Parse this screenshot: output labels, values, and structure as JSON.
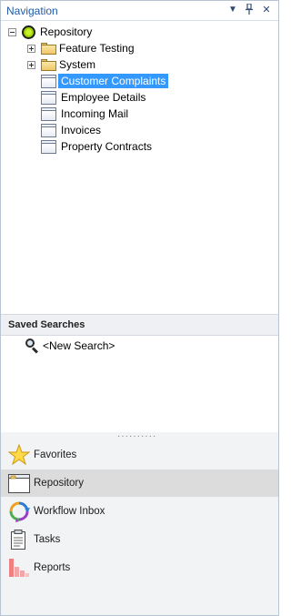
{
  "title": "Navigation",
  "title_buttons": {
    "dropdown": "▼",
    "pin": "📌",
    "close": "✕"
  },
  "tree": {
    "root": {
      "label": "Repository",
      "icon": "repository-icon"
    },
    "items": [
      {
        "label": "Feature Testing",
        "icon": "folder-icon",
        "expandable": true
      },
      {
        "label": "System",
        "icon": "folder-icon",
        "expandable": true
      },
      {
        "label": "Customer Complaints",
        "icon": "document-class-icon",
        "selected": true
      },
      {
        "label": "Employee Details",
        "icon": "document-class-icon"
      },
      {
        "label": "Incoming Mail",
        "icon": "document-class-icon"
      },
      {
        "label": "Invoices",
        "icon": "document-class-icon"
      },
      {
        "label": "Property Contracts",
        "icon": "document-class-icon"
      }
    ]
  },
  "saved_searches": {
    "header": "Saved Searches",
    "items": [
      {
        "label": "<New Search>",
        "icon": "search-icon"
      }
    ]
  },
  "splitter": {
    "dots": "··········"
  },
  "nav": {
    "items": [
      {
        "label": "Favorites",
        "icon": "star-icon"
      },
      {
        "label": "Repository",
        "icon": "repository-window-icon",
        "selected": true
      },
      {
        "label": "Workflow Inbox",
        "icon": "workflow-icon"
      },
      {
        "label": "Tasks",
        "icon": "clipboard-icon"
      },
      {
        "label": "Reports",
        "icon": "bar-chart-icon"
      }
    ]
  },
  "colors": {
    "accent": "#1e5aa8",
    "selection": "#3399ff",
    "nav_selected": "#dcdcdc"
  }
}
